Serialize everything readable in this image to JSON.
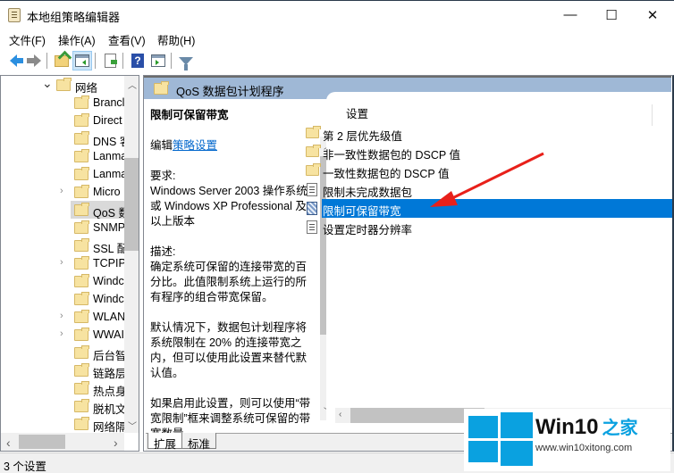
{
  "window": {
    "title": "本地组策略编辑器",
    "controls": {
      "minimize": "—",
      "maximize": "☐",
      "close": "✕"
    }
  },
  "menu": [
    "文件(F)",
    "操作(A)",
    "查看(V)",
    "帮助(H)"
  ],
  "toolbar": {
    "buttons": [
      "back",
      "forward",
      "up-one-level",
      "show-hide-console-tree",
      "export-list",
      "help",
      "show-hide-action-pane",
      "filter"
    ]
  },
  "tree": {
    "items": [
      {
        "label": "网络",
        "expander": "open"
      },
      {
        "label": "Brancl",
        "expander": "none"
      },
      {
        "label": "Direct",
        "expander": "none"
      },
      {
        "label": "DNS 客",
        "expander": "none"
      },
      {
        "label": "Lanma",
        "expander": "none"
      },
      {
        "label": "Lanma",
        "expander": "none"
      },
      {
        "label": "Micro",
        "expander": "closed"
      },
      {
        "label": "QoS 数",
        "expander": "closed",
        "selected": true
      },
      {
        "label": "SNMP",
        "expander": "none"
      },
      {
        "label": "SSL 配",
        "expander": "none"
      },
      {
        "label": "TCPIP",
        "expander": "closed"
      },
      {
        "label": "Windc",
        "expander": "none"
      },
      {
        "label": "Windc",
        "expander": "none"
      },
      {
        "label": "WLAN",
        "expander": "closed"
      },
      {
        "label": "WWAI",
        "expander": "closed"
      },
      {
        "label": "后台智",
        "expander": "none"
      },
      {
        "label": "链路层",
        "expander": "none"
      },
      {
        "label": "热点身",
        "expander": "none"
      },
      {
        "label": "脱机文",
        "expander": "none"
      },
      {
        "label": "网络隔",
        "expander": "none"
      }
    ]
  },
  "detail": {
    "header": "QoS 数据包计划程序",
    "setting_title": "限制可保留带宽",
    "edit_prefix": "编辑",
    "edit_link": "策略设置",
    "requirements_label": "要求:",
    "requirements_text": "Windows Server 2003 操作系统或 Windows XP Professional 及以上版本",
    "description_label": "描述:",
    "description_p1": "确定系统可保留的连接带宽的百分比。此值限制系统上运行的所有程序的组合带宽保留。",
    "description_p2": "默认情况下，数据包计划程序将系统限制在 20% 的连接带宽之内，但可以使用此设置来替代默认值。",
    "description_p3": "如果启用此设置，则可以使用“带宽限制”框来调整系统可保留的带宽数量。"
  },
  "list": {
    "column_header": "设置",
    "rows": [
      {
        "label": "第 2 层优先级值",
        "type": "folder"
      },
      {
        "label": "非一致性数据包的 DSCP 值",
        "type": "folder"
      },
      {
        "label": "一致性数据包的 DSCP 值",
        "type": "folder"
      },
      {
        "label": "限制未完成数据包",
        "type": "setting"
      },
      {
        "label": "限制可保留带宽",
        "type": "setting",
        "selected": true
      },
      {
        "label": "设置定时器分辨率",
        "type": "setting"
      }
    ]
  },
  "tabs": [
    "扩展",
    "标准"
  ],
  "status": "3 个设置",
  "colors": {
    "selection": "#0078d7",
    "header_band": "#9fb8d6",
    "link": "#0066cc",
    "annotation_arrow": "#e8201a",
    "watermark_blue": "#0aa1e0"
  },
  "watermark": {
    "title": "Win10",
    "title_cn": "之家",
    "url": "www.win10xitong.com"
  }
}
